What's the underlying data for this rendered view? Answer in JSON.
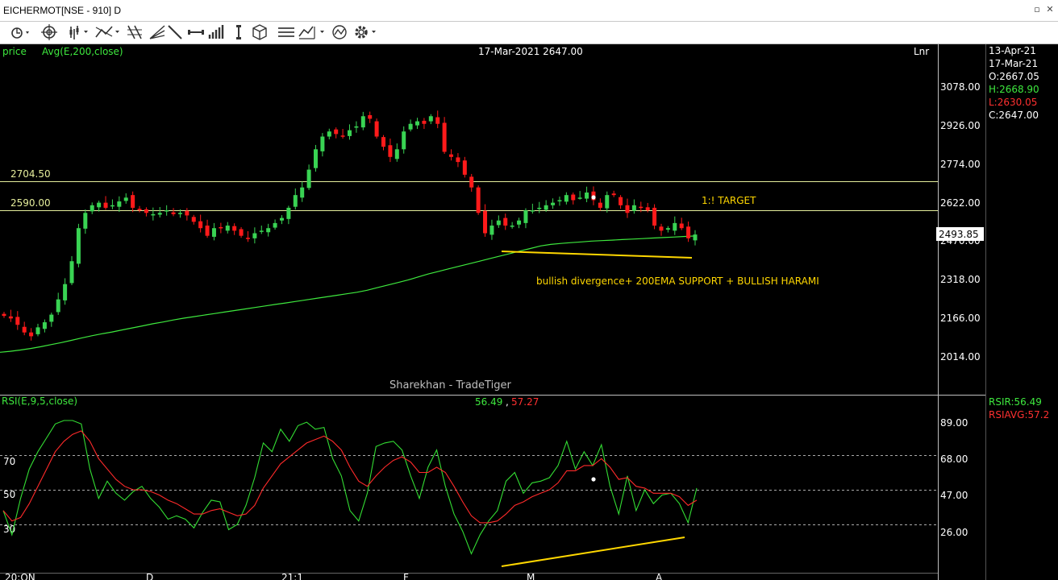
{
  "window": {
    "title": "EICHERMOT[NSE - 910] D"
  },
  "toolbar": {
    "icons": [
      "cursor-menu-icon",
      "crosshair-icon",
      "bar-style-icon",
      "draw-tools-icon",
      "fib-icon",
      "trendline-icon",
      "horizontal-line-icon",
      "volume-bars-icon",
      "vertical-line-icon",
      "cube-icon",
      "lines-icon",
      "scale-icon",
      "compare-icon",
      "settings-icon"
    ]
  },
  "price_panel": {
    "label": "price",
    "indicator": "Avg(E,200,close)",
    "crosshair_readout": "17-Mar-2021 2647.00",
    "scale_mode": "Lnr",
    "watermark": "Sharekhan - TradeTiger",
    "levels": [
      {
        "label": "2704.50",
        "value": 2704.5,
        "color": "#e6ee9c"
      },
      {
        "label": "2590.00",
        "value": 2590.0,
        "color": "#e6ee9c"
      }
    ],
    "target_text": "1:! TARGET",
    "annotation": "bullish divergence+ 200EMA SUPPORT + BULLISH HARAMI",
    "last_price": "2493.85",
    "y_ticks": [
      "3078.00",
      "2926.00",
      "2774.00",
      "2622.00",
      "2470.00",
      "2318.00",
      "2166.00",
      "2014.00"
    ],
    "ohlc": {
      "date1": "13-Apr-21",
      "date2": "17-Mar-21",
      "open": "O:2667.05",
      "high": "H:2668.90",
      "low": "L:2630.05",
      "close": "C:2647.00"
    }
  },
  "rsi_panel": {
    "label": "RSI(E,9,5,close)",
    "value1": "56.49",
    "sep": ",",
    "value2": "57.27",
    "rsi_text": "RSIR:56.49",
    "rsiavg_text": "RSIAVG:57.2",
    "y_ticks": [
      "89.00",
      "68.00",
      "47.00",
      "26.00"
    ],
    "levels": [
      "70",
      "50",
      "30"
    ]
  },
  "x_axis": {
    "labels": [
      "20:ON",
      "D",
      "21:1",
      "F",
      "M",
      "A"
    ]
  },
  "colors": {
    "up": "#39d353",
    "down": "#ff1a1a",
    "ema": "#3ee83e",
    "rsi": "#33dd33",
    "rsiavg": "#ff2a2a",
    "yellow": "#ffd700"
  },
  "chart_data": [
    {
      "type": "line",
      "title": "EICHERMOT[NSE - 910] D",
      "series": [
        {
          "name": "price",
          "values": [
            2175,
            2165,
            2140,
            2110,
            2095,
            2130,
            2150,
            2180,
            2240,
            2300,
            2390,
            2520,
            2580,
            2610,
            2620,
            2600,
            2610,
            2625,
            2640,
            2600,
            2590,
            2580,
            2575,
            2580,
            2590,
            2575,
            2580,
            2570,
            2545,
            2520,
            2490,
            2520,
            2520,
            2530,
            2510,
            2490,
            2480,
            2500,
            2510,
            2520,
            2540,
            2560,
            2600,
            2650,
            2680,
            2750,
            2830,
            2880,
            2900,
            2890,
            2880,
            2905,
            2920,
            2960,
            2950,
            2880,
            2840,
            2800,
            2830,
            2900,
            2930,
            2940,
            2930,
            2960,
            2930,
            2820,
            2800,
            2780,
            2730,
            2680,
            2580,
            2500,
            2530,
            2550,
            2530,
            2530,
            2550,
            2590,
            2590,
            2600,
            2610,
            2620,
            2630,
            2650,
            2630,
            2640,
            2660,
            2630,
            2600,
            2650,
            2650,
            2610,
            2580,
            2610,
            2600,
            2590,
            2530,
            2510,
            2520,
            2540,
            2520,
            2480,
            2495
          ]
        },
        {
          "name": "Avg(E,200,close)",
          "values": [
            2032,
            2036,
            2041,
            2047,
            2054,
            2062,
            2070,
            2079,
            2088,
            2097,
            2105,
            2112,
            2120,
            2128,
            2136,
            2144,
            2151,
            2159,
            2166,
            2172,
            2178,
            2184,
            2190,
            2196,
            2202,
            2208,
            2214,
            2220,
            2226,
            2232,
            2238,
            2244,
            2250,
            2256,
            2262,
            2268,
            2276,
            2286,
            2296,
            2306,
            2316,
            2328,
            2340,
            2350,
            2360,
            2370,
            2380,
            2390,
            2400,
            2410,
            2420,
            2430,
            2440,
            2450,
            2456,
            2460,
            2463,
            2466,
            2469,
            2471,
            2473,
            2475,
            2477,
            2479,
            2481,
            2483,
            2485,
            2487,
            2489
          ]
        }
      ],
      "x_labels": [
        "20:ON",
        "D",
        "21:1",
        "F",
        "M",
        "A"
      ],
      "ylabel": "",
      "ylim": [
        1960,
        3180
      ],
      "scale": "linear"
    },
    {
      "type": "line",
      "title": "RSI(E,9,5,close)",
      "series": [
        {
          "name": "RSIR",
          "values": [
            38,
            24,
            45,
            62,
            72,
            80,
            88,
            90,
            90,
            88,
            62,
            45,
            55,
            48,
            44,
            49,
            52,
            45,
            40,
            33,
            35,
            33,
            28,
            37,
            44,
            43,
            27,
            30,
            41,
            57,
            77,
            72,
            85,
            78,
            87,
            89,
            85,
            86,
            68,
            58,
            38,
            32,
            48,
            75,
            77,
            78,
            73,
            58,
            45,
            63,
            73,
            52,
            36,
            26,
            13,
            24,
            32,
            38,
            55,
            60,
            48,
            54,
            55,
            57,
            64,
            78,
            62,
            72,
            64,
            76,
            52,
            36,
            58,
            38,
            50,
            42,
            47,
            48,
            42,
            31,
            51
          ]
        },
        {
          "name": "RSIAVG",
          "values": [
            38,
            32,
            34,
            42,
            52,
            62,
            72,
            78,
            82,
            84,
            78,
            68,
            62,
            56,
            52,
            50,
            50,
            49,
            47,
            44,
            42,
            39,
            36,
            36,
            38,
            39,
            37,
            35,
            36,
            41,
            51,
            58,
            65,
            69,
            73,
            77,
            79,
            81,
            78,
            73,
            63,
            55,
            52,
            58,
            63,
            67,
            69,
            66,
            60,
            60,
            63,
            60,
            52,
            43,
            35,
            31,
            31,
            32,
            36,
            41,
            43,
            46,
            48,
            50,
            54,
            61,
            61,
            64,
            64,
            68,
            63,
            56,
            57,
            52,
            51,
            48,
            48,
            48,
            46,
            41,
            44
          ]
        }
      ],
      "levels": [
        70,
        50,
        30
      ],
      "ylim": [
        5,
        100
      ]
    }
  ]
}
